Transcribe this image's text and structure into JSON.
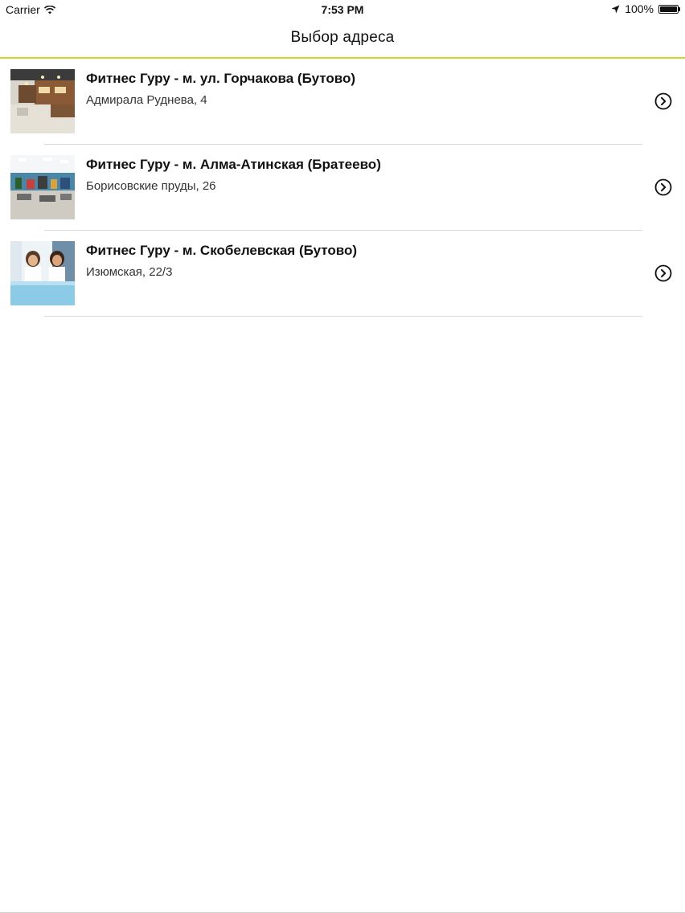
{
  "status_bar": {
    "carrier": "Carrier",
    "time": "7:53 PM",
    "battery": "100%"
  },
  "nav": {
    "title": "Выбор адреса"
  },
  "accent_color": "#c9dc2a",
  "addresses": [
    {
      "title": "Фитнес Гуру - м. ул. Горчакова (Бутово)",
      "address": "Адмирала Руднева, 4",
      "thumbnail": "gym-interior-photo"
    },
    {
      "title": "Фитнес Гуру - м. Алма-Атинская (Братеево)",
      "address": "Борисовские пруды, 26",
      "thumbnail": "gym-hall-photo"
    },
    {
      "title": "Фитнес Гуру - м. Скобелевская (Бутово)",
      "address": "Изюмская, 22/3",
      "thumbnail": "reception-staff-photo"
    }
  ]
}
